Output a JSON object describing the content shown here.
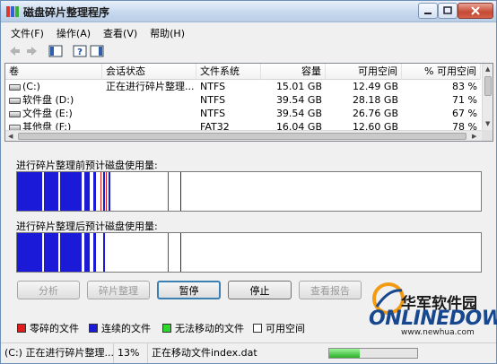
{
  "window": {
    "title": "磁盘碎片整理程序"
  },
  "menu": [
    {
      "label": "文件(F)"
    },
    {
      "label": "操作(A)"
    },
    {
      "label": "查看(V)"
    },
    {
      "label": "帮助(H)"
    }
  ],
  "volumes": {
    "columns": [
      "卷",
      "会话状态",
      "文件系统",
      "容量",
      "可用空间",
      "% 可用空间"
    ],
    "rows": [
      {
        "volume": "(C:)",
        "status": "正在进行碎片整理...",
        "fs": "NTFS",
        "capacity": "15.01 GB",
        "free": "12.49 GB",
        "pct": "83 %"
      },
      {
        "volume": "软件盘 (D:)",
        "status": "",
        "fs": "NTFS",
        "capacity": "39.54 GB",
        "free": "28.18 GB",
        "pct": "71 %"
      },
      {
        "volume": "文件盘 (E:)",
        "status": "",
        "fs": "NTFS",
        "capacity": "39.54 GB",
        "free": "26.76 GB",
        "pct": "67 %"
      },
      {
        "volume": "其他盘 (F:)",
        "status": "",
        "fs": "FAT32",
        "capacity": "16.04 GB",
        "free": "12.60 GB",
        "pct": "78 %"
      }
    ]
  },
  "before": {
    "label": "进行碎片整理前预计磁盘使用量:"
  },
  "after": {
    "label": "进行碎片整理后预计磁盘使用量:"
  },
  "buttons": {
    "analyze": "分析",
    "defrag": "碎片整理",
    "pause": "暂停",
    "stop": "停止",
    "report": "查看报告"
  },
  "legend": [
    {
      "label": "零碎的文件",
      "color": "#e31b1b"
    },
    {
      "label": "连续的文件",
      "color": "#1a1ad8"
    },
    {
      "label": "无法移动的文件",
      "color": "#2fd62f"
    },
    {
      "label": "可用空间",
      "color": "#ffffff"
    }
  ],
  "watermark": {
    "cn": "华军软件园",
    "en": "ONLINEDOWN",
    "url": "www.newhua.com"
  },
  "status": {
    "volume_status": "(C:) 正在进行碎片整理...",
    "percent": "13%",
    "moving": "正在移动文件index.dat",
    "progress": 0.35
  },
  "colors": {
    "used": "#1a1ad8",
    "fragmented": "#e31b1b",
    "free": "#ffffff"
  }
}
